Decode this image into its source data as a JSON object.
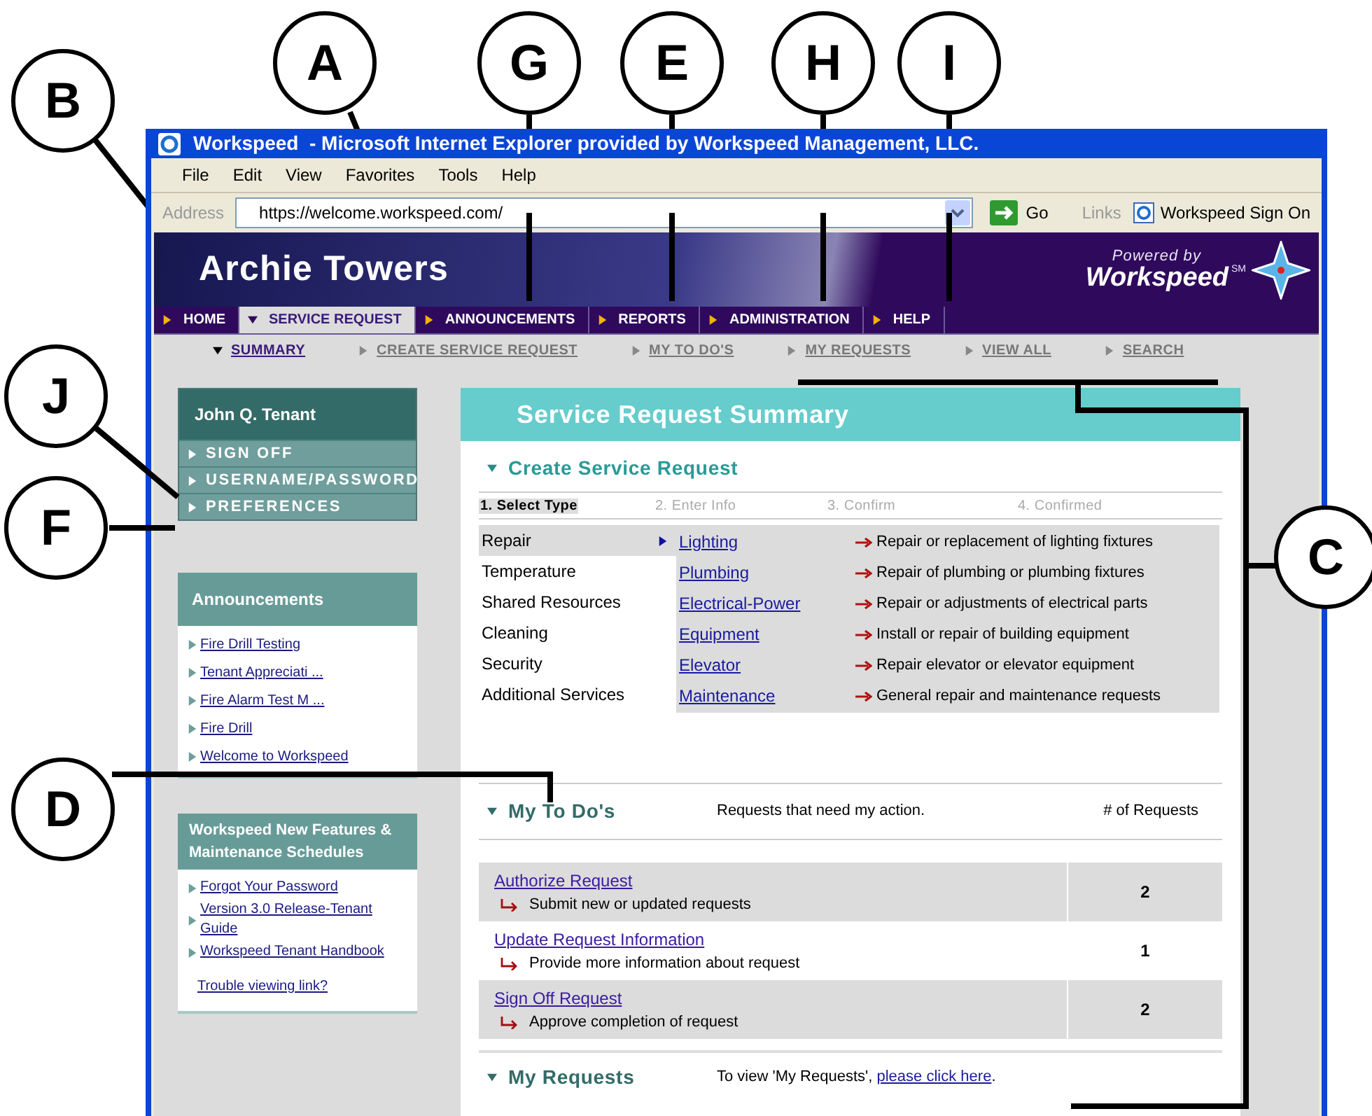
{
  "callouts": [
    {
      "label": "A"
    },
    {
      "label": "G"
    },
    {
      "label": "E"
    },
    {
      "label": "H"
    },
    {
      "label": "I"
    },
    {
      "label": "B"
    },
    {
      "label": "J"
    },
    {
      "label": "F"
    },
    {
      "label": "C"
    },
    {
      "label": "D"
    }
  ],
  "window": {
    "title": "Workspeed  - Microsoft Internet Explorer provided by Workspeed Management, LLC."
  },
  "menu": [
    "File",
    "Edit",
    "View",
    "Favorites",
    "Tools",
    "Help"
  ],
  "address_bar": {
    "label": "Address",
    "value": "https://welcome.workspeed.com/",
    "go": "Go",
    "links": "Links",
    "link_item": "Workspeed Sign On"
  },
  "banner": {
    "title": "Archie Towers",
    "powered_by": "Powered by",
    "brand": "Workspeed",
    "brand_mark": "SM"
  },
  "nav_tabs": [
    {
      "label": "HOME",
      "selected": false
    },
    {
      "label": "SERVICE REQUEST",
      "selected": true
    },
    {
      "label": "ANNOUNCEMENTS",
      "selected": false
    },
    {
      "label": "REPORTS",
      "selected": false
    },
    {
      "label": "ADMINISTRATION",
      "selected": false
    },
    {
      "label": "HELP",
      "selected": false
    }
  ],
  "sub_nav": [
    {
      "label": "SUMMARY",
      "selected": true
    },
    {
      "label": "CREATE SERVICE REQUEST",
      "selected": false
    },
    {
      "label": "MY TO DO'S",
      "selected": false
    },
    {
      "label": "MY REQUESTS",
      "selected": false
    },
    {
      "label": "VIEW ALL",
      "selected": false
    },
    {
      "label": "SEARCH",
      "selected": false
    }
  ],
  "user_panel": {
    "name": "John Q. Tenant",
    "links": [
      "SIGN OFF",
      "USERNAME/PASSWORD",
      "PREFERENCES"
    ]
  },
  "announcements": {
    "title": "Announcements",
    "items": [
      "Fire Drill Testing",
      "Tenant Appreciati ...",
      "Fire Alarm Test M ...",
      "Fire Drill",
      "Welcome to Workspeed"
    ]
  },
  "features": {
    "title": "Workspeed New Features & Maintenance Schedules",
    "items": [
      "Forgot Your Password",
      "Version 3.0 Release-Tenant Guide",
      "Workspeed Tenant Handbook"
    ],
    "help_link": "Trouble viewing link?"
  },
  "main": {
    "title": "Service Request Summary",
    "create": {
      "heading": "Create Service Request",
      "steps": [
        {
          "label": "1. Select Type",
          "selected": true
        },
        {
          "label": "2. Enter Info",
          "selected": false
        },
        {
          "label": "3. Confirm",
          "selected": false
        },
        {
          "label": "4. Confirmed",
          "selected": false
        }
      ],
      "categories": [
        {
          "label": "Repair",
          "selected": true
        },
        {
          "label": "Temperature",
          "selected": false
        },
        {
          "label": "Shared Resources",
          "selected": false
        },
        {
          "label": "Cleaning",
          "selected": false
        },
        {
          "label": "Security",
          "selected": false
        },
        {
          "label": "Additional Services",
          "selected": false
        }
      ],
      "types": [
        {
          "link": "Lighting",
          "description": "Repair or replacement of lighting fixtures"
        },
        {
          "link": "Plumbing",
          "description": "Repair of plumbing or plumbing fixtures"
        },
        {
          "link": "Electrical-Power",
          "description": "Repair or adjustments of electrical parts"
        },
        {
          "link": "Equipment",
          "description": "Install or repair of building equipment"
        },
        {
          "link": "Elevator",
          "description": "Repair elevator or elevator equipment"
        },
        {
          "link": "Maintenance",
          "description": "General repair and maintenance requests"
        }
      ]
    },
    "todos": {
      "heading": "My To Do's",
      "description": "Requests that need my action.",
      "count_header": "# of Requests",
      "rows": [
        {
          "link": "Authorize Request",
          "description": "Submit new or updated requests",
          "count": "2"
        },
        {
          "link": "Update Request Information",
          "description": "Provide more information about request",
          "count": "1"
        },
        {
          "link": "Sign Off Request",
          "description": "Approve completion of request",
          "count": "2"
        }
      ]
    },
    "my_requests": {
      "heading": "My Requests",
      "text": "To view 'My Requests', ",
      "link": "please click here",
      "after": "."
    }
  }
}
